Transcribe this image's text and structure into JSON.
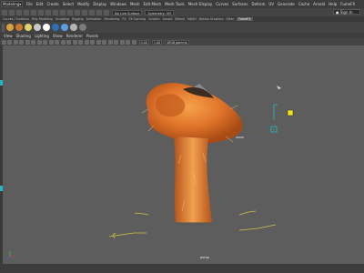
{
  "menubar": {
    "mode": "Modeling",
    "items": [
      "File",
      "Edit",
      "Create",
      "Select",
      "Modify",
      "Display",
      "Windows",
      "Mesh",
      "Edit Mesh",
      "Mesh Tools",
      "Mesh Display",
      "Curves",
      "Surfaces",
      "Deform",
      "UV",
      "Generate",
      "Cache",
      "Arnold",
      "Help",
      "FumeFX"
    ]
  },
  "statusline": {
    "live_surface": "No Live Surface",
    "symmetry": "Symmetry: Off",
    "sign_in": "Sign In"
  },
  "shelf_tabs": [
    {
      "label": "Curves / Surfaces",
      "active": false
    },
    {
      "label": "Poly Modeling",
      "active": false
    },
    {
      "label": "Sculpting",
      "active": false
    },
    {
      "label": "Rigging",
      "active": false
    },
    {
      "label": "Animation",
      "active": false
    },
    {
      "label": "Rendering",
      "active": false
    },
    {
      "label": "FX",
      "active": false
    },
    {
      "label": "FX Caching",
      "active": false
    },
    {
      "label": "Custom",
      "active": false
    },
    {
      "label": "Arnold",
      "active": false
    },
    {
      "label": "Bifrost",
      "active": false
    },
    {
      "label": "MASH",
      "active": false
    },
    {
      "label": "Motion Graphics",
      "active": false
    },
    {
      "label": "XGen",
      "active": false
    },
    {
      "label": "FumeFX",
      "active": true
    }
  ],
  "shelf_icon_colors": [
    "#d9a13b",
    "#c9772e",
    "#e0d36a",
    "#c8c8c8",
    "#ffffff",
    "#2f6fb4",
    "#5aa0e0",
    "#b5b5b5",
    "#7a7a7a"
  ],
  "view_menu": [
    "View",
    "Shading",
    "Lighting",
    "Show",
    "Renderer",
    "Panels"
  ],
  "view_toolbar": {
    "value_a": "0.00",
    "value_b": "1.00",
    "color_space": "sRGB gamma"
  },
  "viewport": {
    "camera": "persp",
    "object": "fur-covered mushroom-shaped mesh",
    "fur_color": "#e0742a",
    "background": "#5d5d5d"
  }
}
